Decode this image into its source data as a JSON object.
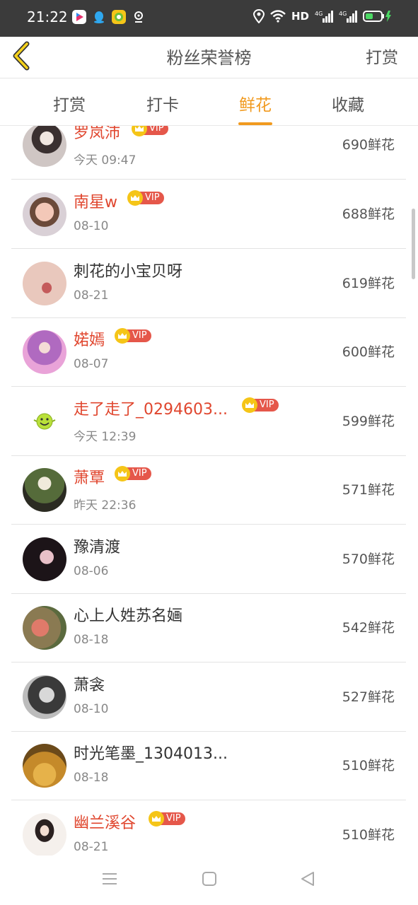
{
  "status_bar": {
    "time": "21:22",
    "network_label": "HD",
    "icons": [
      "video-app-icon",
      "qq-icon",
      "game-app-icon",
      "location-icon",
      "wifi-icon",
      "signal-4g-icon",
      "signal-4g-icon-2",
      "battery-icon"
    ]
  },
  "header": {
    "title": "粉丝荣誉榜",
    "action": "打赏"
  },
  "tabs": [
    {
      "label": "打赏",
      "active": false
    },
    {
      "label": "打卡",
      "active": false
    },
    {
      "label": "鲜花",
      "active": true
    },
    {
      "label": "收藏",
      "active": false
    }
  ],
  "vip_label": "VIP",
  "colors": {
    "accent": "#f19a1f",
    "vip_name": "#e0462e",
    "vip_badge": "#e5574a",
    "crown": "#f5c518"
  },
  "rows": [
    {
      "name": "罗岚沛",
      "date": "今天 09:47",
      "count": "690鲜花",
      "vip": true
    },
    {
      "name": "南星w",
      "date": "08-10",
      "count": "688鲜花",
      "vip": true
    },
    {
      "name": "刺花的小宝贝呀",
      "date": "08-21",
      "count": "619鲜花",
      "vip": false
    },
    {
      "name": "婼嫣",
      "date": "08-07",
      "count": "600鲜花",
      "vip": true
    },
    {
      "name": "走了走了_0294603...",
      "date": "今天 12:39",
      "count": "599鲜花",
      "vip": true
    },
    {
      "name": "萧覃",
      "date": "昨天 22:36",
      "count": "571鲜花",
      "vip": true
    },
    {
      "name": "豫清渡",
      "date": "08-06",
      "count": "570鲜花",
      "vip": false
    },
    {
      "name": "心上人姓苏名婳",
      "date": "08-18",
      "count": "542鲜花",
      "vip": false
    },
    {
      "name": "萧衾",
      "date": "08-10",
      "count": "527鲜花",
      "vip": false
    },
    {
      "name": "时光笔墨_1304013...",
      "date": "08-18",
      "count": "510鲜花",
      "vip": false
    },
    {
      "name": "幽兰溪谷",
      "date": "08-21",
      "count": "510鲜花",
      "vip": true
    }
  ]
}
